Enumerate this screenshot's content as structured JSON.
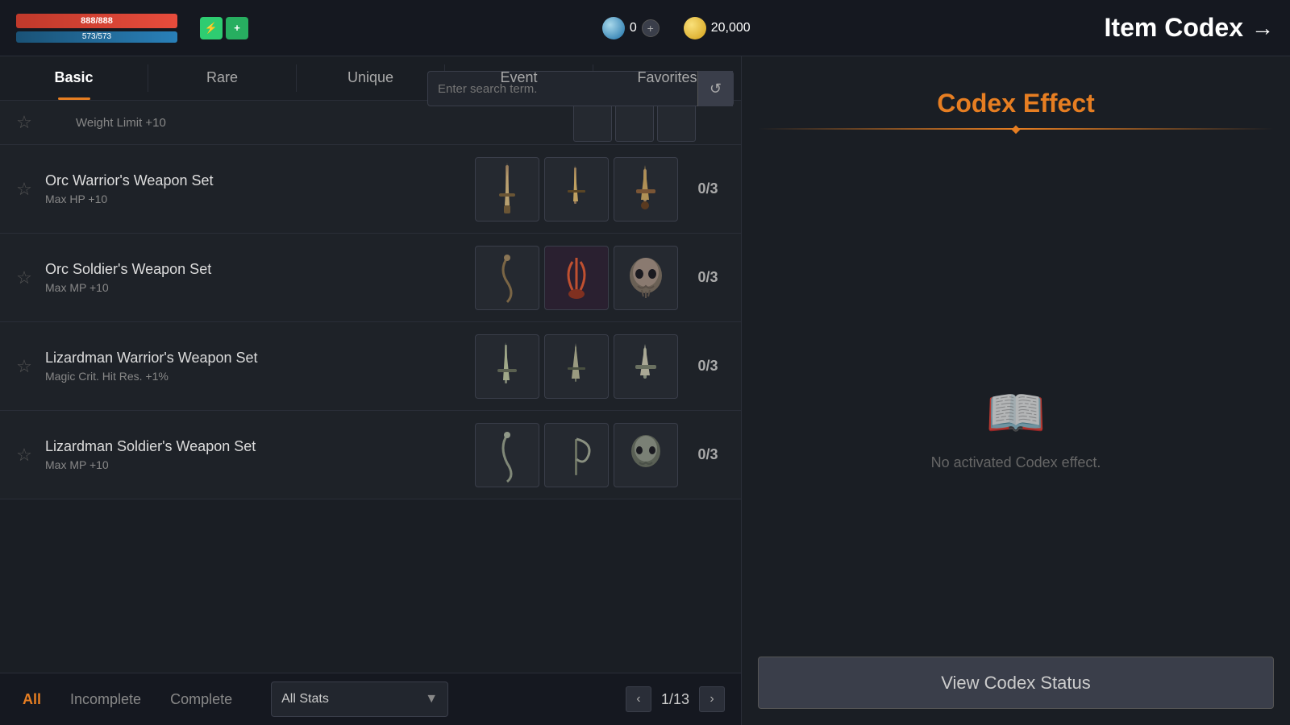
{
  "topbar": {
    "hp": "888/888",
    "mp": "573/573",
    "gem_count": "0",
    "coin_count": "20,000",
    "add_label": "+",
    "title": "Item Codex",
    "title_arrow": "→"
  },
  "tabs": [
    {
      "id": "basic",
      "label": "Basic",
      "active": true
    },
    {
      "id": "rare",
      "label": "Rare",
      "active": false
    },
    {
      "id": "unique",
      "label": "Unique",
      "active": false
    },
    {
      "id": "event",
      "label": "Event",
      "active": false
    },
    {
      "id": "favorites",
      "label": "Favorites",
      "active": false
    }
  ],
  "search": {
    "placeholder": "Enter search term."
  },
  "partial_row": {
    "text": "Weight Limit +10"
  },
  "items": [
    {
      "id": "orc-warrior",
      "name": "Orc Warrior's Weapon Set",
      "stat": "Max HP +10",
      "count": "0/3",
      "icons": [
        "⚔",
        "🗡",
        "🔪"
      ]
    },
    {
      "id": "orc-soldier",
      "name": "Orc Soldier's Weapon Set",
      "stat": "Max MP +10",
      "count": "0/3",
      "icons": [
        "🪃",
        "🦅",
        "💀"
      ]
    },
    {
      "id": "lizardman-warrior",
      "name": "Lizardman Warrior's Weapon Set",
      "stat": "Magic Crit. Hit Res. +1%",
      "count": "0/3",
      "icons": [
        "🗡",
        "🔪",
        "⚔"
      ]
    },
    {
      "id": "lizardman-soldier",
      "name": "Lizardman Soldier's Weapon Set",
      "stat": "Max MP +10",
      "count": "0/3",
      "icons": [
        "🪃",
        "🦅",
        "🎭"
      ]
    }
  ],
  "bottom": {
    "filter_all": "All",
    "filter_incomplete": "Incomplete",
    "filter_complete": "Complete",
    "stats_dropdown": "All Stats",
    "page_current": "1",
    "page_total": "13",
    "prev_arrow": "‹",
    "next_arrow": "›"
  },
  "right_panel": {
    "title": "Codex Effect",
    "empty_text": "No activated Codex effect.",
    "view_btn": "View Codex Status",
    "book_icon": "📖"
  }
}
